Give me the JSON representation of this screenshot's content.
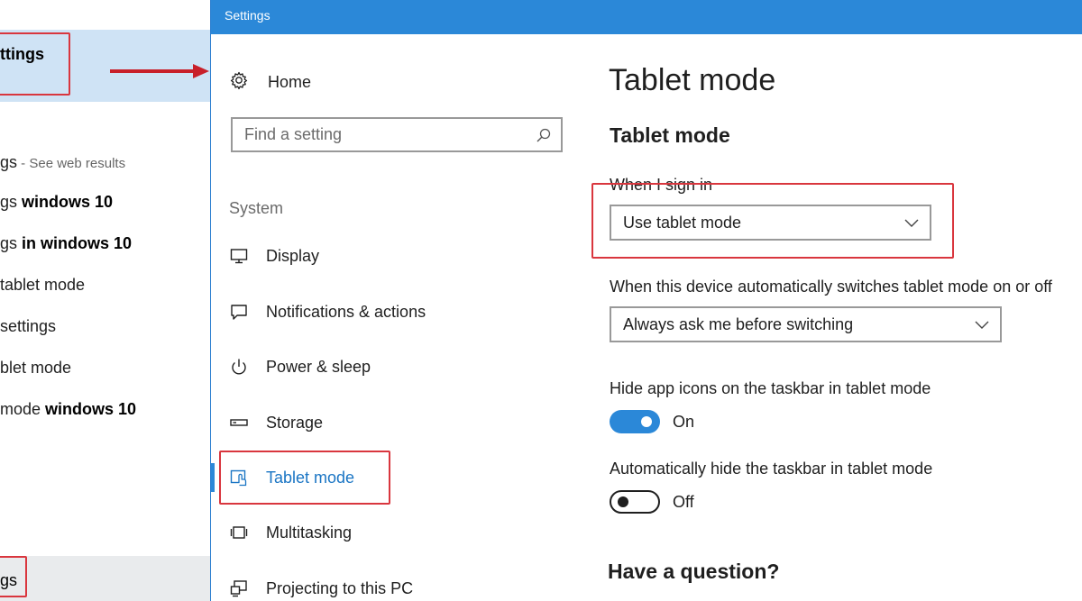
{
  "search_panel": {
    "best_match": "ttings",
    "results": [
      {
        "normal": "gs",
        "bold": "",
        "hint": " - See web results"
      },
      {
        "normal": "gs ",
        "bold": "windows 10",
        "hint": ""
      },
      {
        "normal": "gs ",
        "bold": "in windows 10",
        "hint": ""
      },
      {
        "normal": " tablet mode",
        "bold": "",
        "hint": ""
      },
      {
        "normal": " settings",
        "bold": "",
        "hint": ""
      },
      {
        "normal": "blet mode",
        "bold": "",
        "hint": ""
      },
      {
        "normal": "mode ",
        "bold": "windows 10",
        "hint": ""
      }
    ],
    "search_text": "gs"
  },
  "window": {
    "title": "Settings"
  },
  "nav": {
    "home": "Home",
    "find_placeholder": "Find a setting",
    "section": "System",
    "items": [
      {
        "label": "Display",
        "icon": "display-icon"
      },
      {
        "label": "Notifications & actions",
        "icon": "notifications-icon"
      },
      {
        "label": "Power & sleep",
        "icon": "power-icon"
      },
      {
        "label": "Storage",
        "icon": "storage-icon"
      },
      {
        "label": "Tablet mode",
        "icon": "tablet-mode-icon"
      },
      {
        "label": "Multitasking",
        "icon": "multitasking-icon"
      },
      {
        "label": "Projecting to this PC",
        "icon": "projecting-icon"
      }
    ],
    "active_index": 4
  },
  "content": {
    "page_title": "Tablet mode",
    "section_title": "Tablet mode",
    "sign_in_label": "When I sign in",
    "sign_in_value": "Use tablet mode",
    "switch_label": "When this device automatically switches tablet mode on or off",
    "switch_value": "Always ask me before switching",
    "hide_icons_label": "Hide app icons on the taskbar in tablet mode",
    "hide_icons_state": "On",
    "hide_icons_on": true,
    "hide_taskbar_label": "Automatically hide the taskbar in tablet mode",
    "hide_taskbar_state": "Off",
    "hide_taskbar_on": false,
    "question": "Have a question?"
  },
  "colors": {
    "accent": "#2b88d8",
    "annotation": "#d9363e",
    "best_match_bg": "#cfe3f5"
  }
}
